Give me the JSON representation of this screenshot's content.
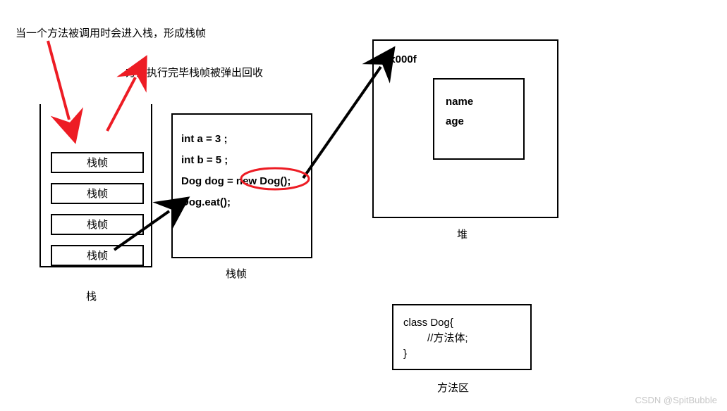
{
  "captions": {
    "top1": "当一个方法被调用时会进入栈，形成栈帧",
    "top2": "方法执行完毕栈帧被弹出回收"
  },
  "stack": {
    "frames": [
      "栈帧",
      "栈帧",
      "栈帧",
      "栈帧"
    ],
    "label": "栈"
  },
  "frameDetail": {
    "label": "栈帧",
    "code": {
      "l1": "int a = 3 ;",
      "l2": "int b = 5 ;",
      "l3": "Dog dog = new Dog();",
      "l4": "Dog.eat();"
    }
  },
  "heap": {
    "label": "堆",
    "address": "0x000f",
    "object": {
      "f1": "name",
      "f2": "age"
    }
  },
  "methodArea": {
    "label": "方法区",
    "code": {
      "l1": "class Dog{",
      "l2": "//方法体;",
      "l3": "}"
    }
  },
  "watermark": "CSDN @SpitBubble"
}
